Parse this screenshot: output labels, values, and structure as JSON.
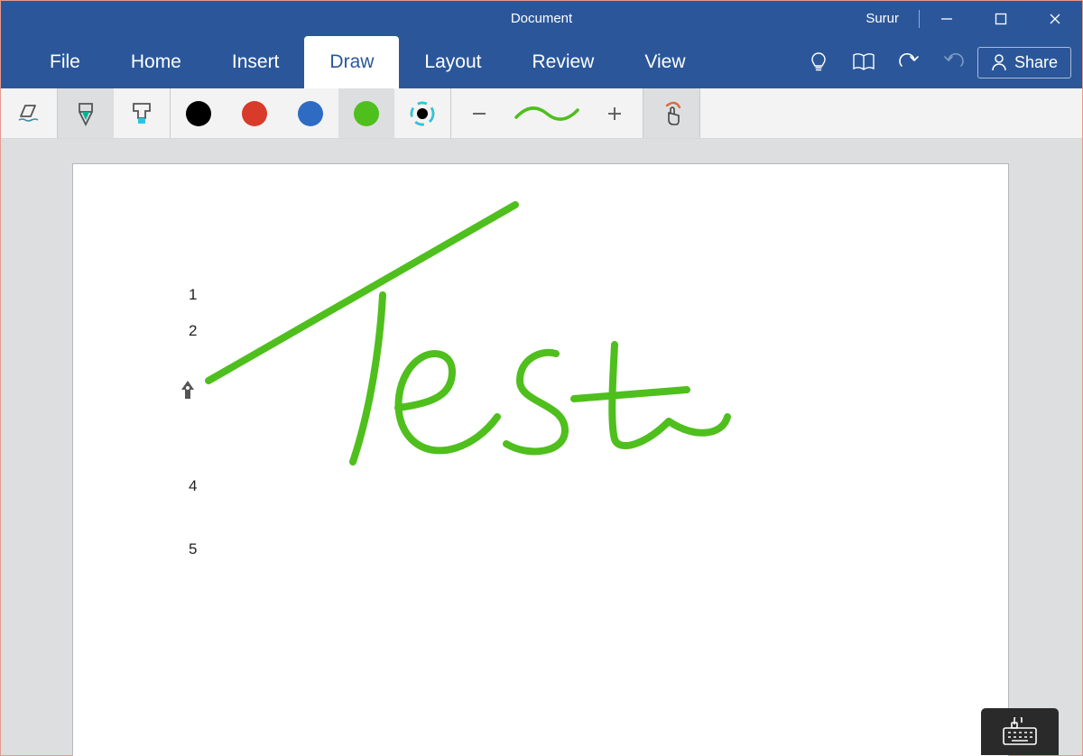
{
  "titlebar": {
    "document_title": "Document",
    "user_name": "Surur"
  },
  "tabs": {
    "items": [
      "File",
      "Home",
      "Insert",
      "Draw",
      "Layout",
      "Review",
      "View"
    ],
    "active_index": 3,
    "share_label": "Share"
  },
  "toolbar": {
    "tools": {
      "eraser": "eraser",
      "pen": "pen",
      "highlighter": "highlighter"
    },
    "colors": {
      "black": "#000000",
      "red": "#d83b2a",
      "blue": "#2e6cc4",
      "green": "#4fbf1d",
      "multicolor": "multicolor"
    },
    "selected_color": "green",
    "stroke_preview_color": "#4fbf1d"
  },
  "document": {
    "line_numbers": [
      "1",
      "2",
      "4",
      "5"
    ],
    "handwriting_text": "Test",
    "ink_color": "#4fbf1d"
  },
  "icons": {
    "minimize": "minimize",
    "maximize": "maximize",
    "close": "close",
    "lightbulb": "tell-me",
    "reading": "reading-view",
    "undo": "undo",
    "redo": "redo",
    "person": "person",
    "keyboard": "touch-keyboard",
    "touch_draw": "draw-with-touch"
  }
}
